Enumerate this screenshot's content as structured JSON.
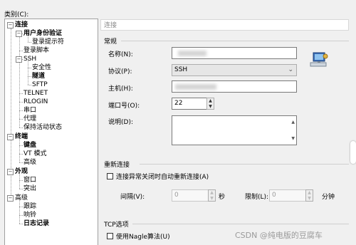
{
  "category_label": "类别(C):",
  "tree": [
    {
      "label": "连接",
      "bold": true
    },
    {
      "label": "用户身份验证",
      "bold": true
    },
    {
      "label": "登录提示符",
      "bold": false
    },
    {
      "label": "登录脚本",
      "bold": false
    },
    {
      "label": "SSH",
      "bold": false
    },
    {
      "label": "安全性",
      "bold": false
    },
    {
      "label": "隧道",
      "bold": true
    },
    {
      "label": "SFTP",
      "bold": false
    },
    {
      "label": "TELNET",
      "bold": false
    },
    {
      "label": "RLOGIN",
      "bold": false
    },
    {
      "label": "串口",
      "bold": false
    },
    {
      "label": "代理",
      "bold": false
    },
    {
      "label": "保持活动状态",
      "bold": false
    },
    {
      "label": "终端",
      "bold": true
    },
    {
      "label": "键盘",
      "bold": true
    },
    {
      "label": "VT 模式",
      "bold": false
    },
    {
      "label": "高级",
      "bold": false
    },
    {
      "label": "外观",
      "bold": true
    },
    {
      "label": "窗口",
      "bold": false
    },
    {
      "label": "突出",
      "bold": false
    },
    {
      "label": "高级",
      "bold": false
    },
    {
      "label": "跟踪",
      "bold": false
    },
    {
      "label": "响铃",
      "bold": false
    },
    {
      "label": "日志记录",
      "bold": true
    }
  ],
  "panel_title": "连接",
  "general": {
    "title": "常规",
    "name_label": "名称(N):",
    "protocol_label": "协议(P):",
    "protocol_value": "SSH",
    "host_label": "主机(H):",
    "host_value": "•••",
    "port_label": "端口号(O):",
    "port_value": "22",
    "desc_label": "说明(D):"
  },
  "reconnect": {
    "title": "重新连接",
    "auto_reconnect_label": "连接异常关闭时自动重新连接(A)",
    "interval_label": "间隔(V):",
    "interval_value": "0",
    "interval_unit": "秒",
    "limit_label": "限制(L):",
    "limit_value": "0",
    "limit_unit": "分钟"
  },
  "tcp": {
    "title": "TCP选项",
    "nagle_label": "使用Nagle算法(U)"
  },
  "watermark": "CSDN @纯电版的豆腐车"
}
